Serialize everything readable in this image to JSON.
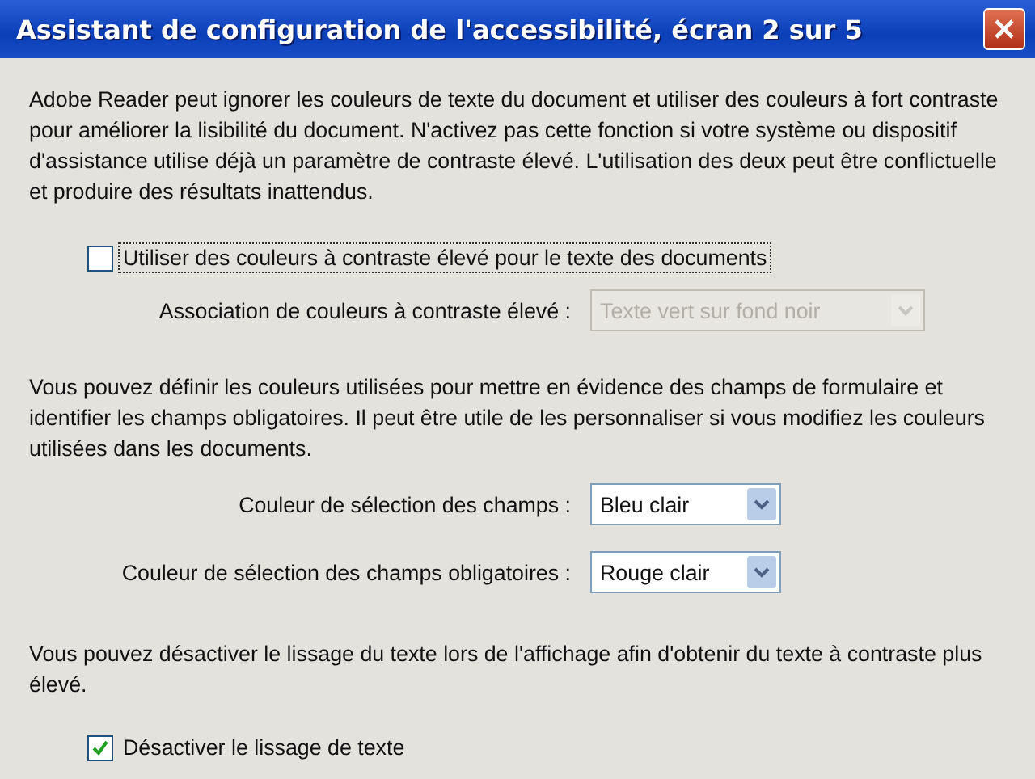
{
  "window": {
    "title": "Assistant de configuration de l'accessibilité, écran 2 sur 5"
  },
  "intro": "Adobe Reader peut ignorer les couleurs de texte du document et utiliser des couleurs à fort contraste pour améliorer la lisibilité du document. N'activez pas cette fonction si votre système ou dispositif d'assistance utilise déjà un paramètre de contraste élevé. L'utilisation des deux peut être conflictuelle et produire des résultats inattendus.",
  "high_contrast": {
    "label": "Utiliser des couleurs à contraste élevé pour le texte des documents",
    "checked": false,
    "focused": true
  },
  "contrast_scheme": {
    "label": "Association de couleurs à contraste élevé :",
    "value": "Texte vert sur fond noir",
    "disabled": true
  },
  "fields_text": "Vous pouvez définir les couleurs utilisées pour mettre en évidence des champs de formulaire et identifier les champs obligatoires. Il peut être utile de les personnaliser si vous modifiez les couleurs utilisées dans les documents.",
  "field_colors": [
    {
      "label": "Couleur de sélection des champs :",
      "value": "Bleu clair",
      "disabled": false
    },
    {
      "label": "Couleur de sélection des champs obligatoires :",
      "value": "Rouge clair",
      "disabled": false
    }
  ],
  "smoothing_text": "Vous pouvez désactiver le lissage du texte lors de l'affichage afin d'obtenir du texte à contraste plus élevé.",
  "disable_smoothing": {
    "label": "Désactiver le lissage de texte",
    "checked": true,
    "focused": false
  }
}
